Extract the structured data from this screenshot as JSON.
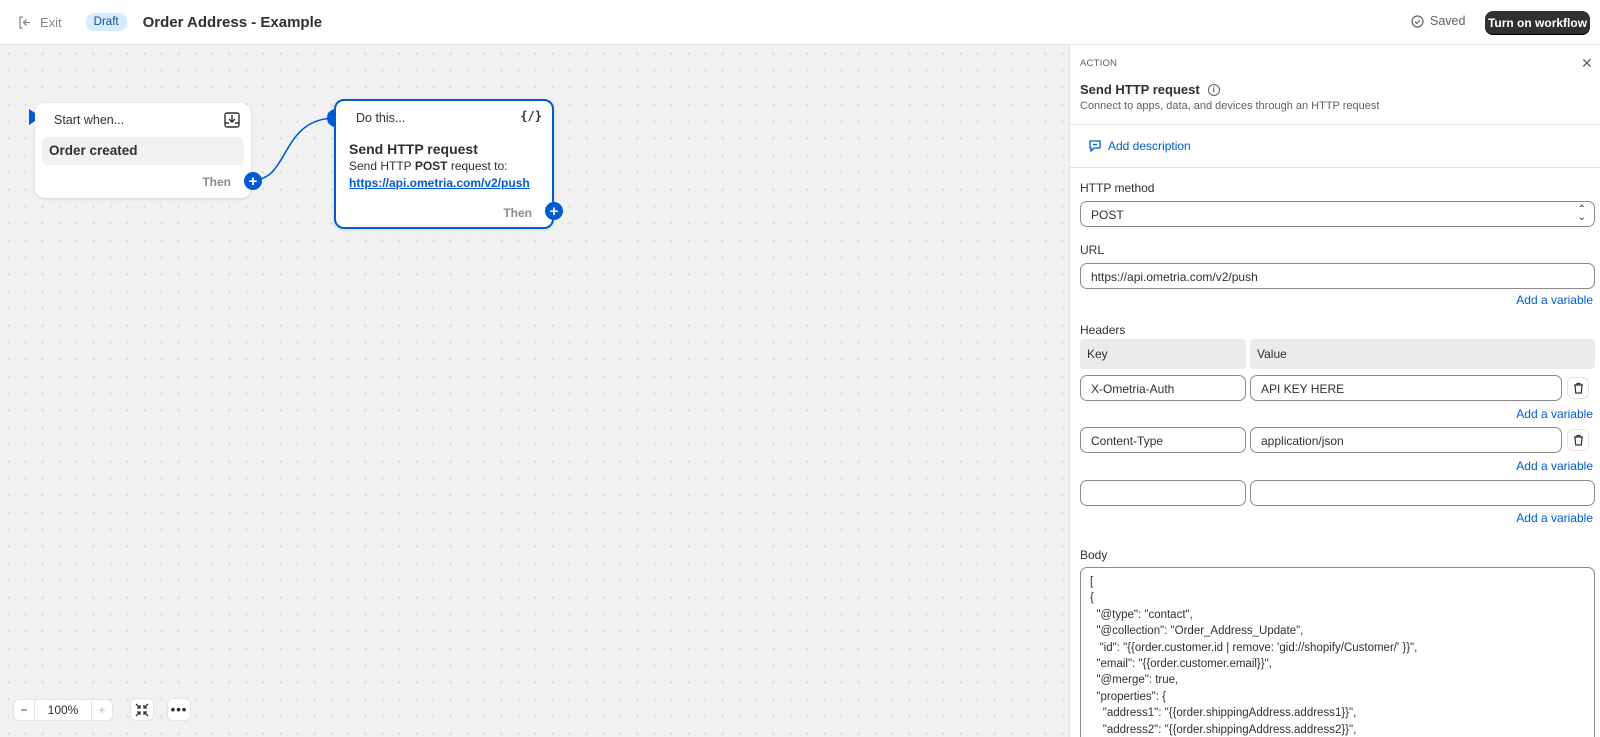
{
  "topbar": {
    "exit_label": "Exit",
    "status_badge": "Draft",
    "title": "Order Address - Example",
    "saved_label": "Saved",
    "turn_on_label": "Turn on workflow"
  },
  "canvas": {
    "start_node": {
      "header": "Start when...",
      "trigger": "Order created",
      "then_label": "Then"
    },
    "action_node": {
      "header": "Do this...",
      "code_icon_text": "{/}",
      "name": "Send HTTP request",
      "desc_prefix": "Send HTTP ",
      "desc_method": "POST",
      "desc_suffix": " request to:",
      "url": "https://api.ometria.com/v2/push",
      "then_label": "Then"
    },
    "zoom": {
      "minus": "−",
      "value": "100%",
      "plus": "+"
    },
    "more_label": "•••"
  },
  "panel": {
    "section_label": "ACTION",
    "close_label": "✕",
    "title": "Send HTTP request",
    "subtitle": "Connect to apps, data, and devices through an HTTP request",
    "add_description": "Add description",
    "http_method_label": "HTTP method",
    "http_method_value": "POST",
    "url_label": "URL",
    "url_value": "https://api.ometria.com/v2/push",
    "add_variable": "Add a variable",
    "headers_label": "Headers",
    "headers_columns": [
      "Key",
      "Value"
    ],
    "headers_rows": [
      {
        "key": "X-Ometria-Auth",
        "value": "API KEY HERE"
      },
      {
        "key": "Content-Type",
        "value": "application/json"
      },
      {
        "key": "",
        "value": ""
      }
    ],
    "body_label": "Body",
    "body_value": "[\n{\n  \"@type\": \"contact\",\n  \"@collection\": \"Order_Address_Update\",\n   \"id\": \"{{order.customer.id | remove: 'gid://shopify/Customer/' }}\",\n  \"email\": \"{{order.customer.email}}\",\n  \"@merge\": true,\n  \"properties\": {\n    \"address1\": \"{{order.shippingAddress.address1}}\",\n    \"address2\": \"{{order.shippingAddress.address2}}\","
  },
  "colors": {
    "accent": "#005bd3",
    "dark_button": "#303030",
    "badge_bg": "#d5ebff"
  }
}
